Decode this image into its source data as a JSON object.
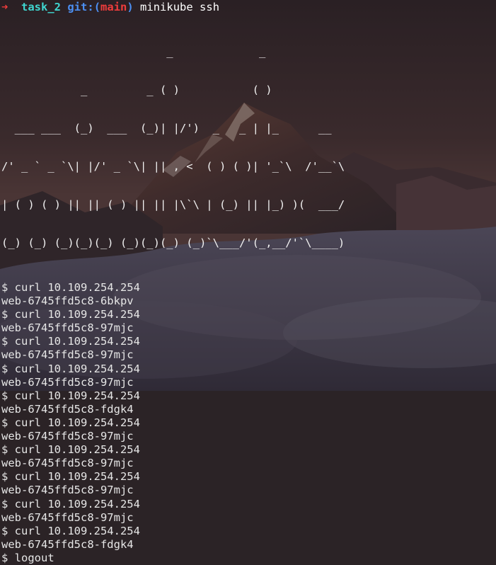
{
  "prompt": {
    "arrow": "➜",
    "directory": "task_2",
    "git_label": "git:",
    "branch_open": "(",
    "branch": "main",
    "branch_close": ")",
    "command": "minikube ssh"
  },
  "banner_lines": [
    "                         _             _            ",
    "            _         _ ( )           ( )           ",
    "  ___ ___  (_)  ___  (_)| |/')  _   _ | |_      __  ",
    "/' _ ` _ `\\| |/' _ `\\| || , <  ( ) ( )| '_`\\  /'__`\\",
    "| ( ) ( ) || || ( ) || || |\\`\\ | (_) || |_) )(  ___/",
    "(_) (_) (_)(_)(_) (_)(_)(_) (_)`\\___/'(_,__/'`\\____)"
  ],
  "session_lines": [
    "$ curl 10.109.254.254",
    "web-6745ffd5c8-6bkpv",
    "$ curl 10.109.254.254",
    "web-6745ffd5c8-97mjc",
    "$ curl 10.109.254.254",
    "web-6745ffd5c8-97mjc",
    "$ curl 10.109.254.254",
    "web-6745ffd5c8-97mjc",
    "$ curl 10.109.254.254",
    "web-6745ffd5c8-fdgk4",
    "$ curl 10.109.254.254",
    "web-6745ffd5c8-97mjc",
    "$ curl 10.109.254.254",
    "web-6745ffd5c8-97mjc",
    "$ curl 10.109.254.254",
    "web-6745ffd5c8-97mjc",
    "$ curl 10.109.254.254",
    "web-6745ffd5c8-97mjc",
    "$ curl 10.109.254.254",
    "web-6745ffd5c8-fdgk4",
    "$ logout"
  ],
  "colors": {
    "arrow": "#ef3c3c",
    "directory": "#3fd6d0",
    "git": "#4c8ff2",
    "branch": "#ef3c3c",
    "text": "#e6e6e6"
  }
}
